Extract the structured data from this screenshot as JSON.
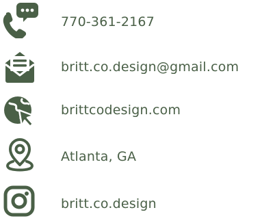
{
  "colors": {
    "icon": "#4a6047",
    "text": "#4a6047",
    "background": "#ffffff"
  },
  "contacts": [
    {
      "icon": "phone-chat-icon",
      "text": "770-361-2167"
    },
    {
      "icon": "email-envelope-icon",
      "text": "britt.co.design@gmail.com"
    },
    {
      "icon": "globe-cursor-icon",
      "text": "brittcodesign.com"
    },
    {
      "icon": "location-pin-icon",
      "text": "Atlanta, GA"
    },
    {
      "icon": "instagram-icon",
      "text": "britt.co.design"
    }
  ]
}
